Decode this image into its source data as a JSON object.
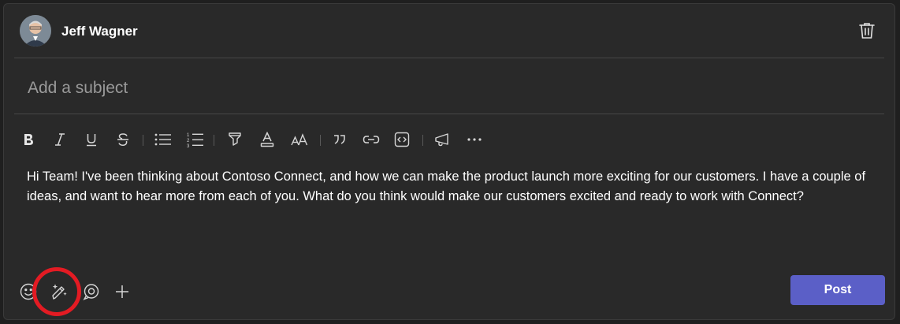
{
  "author": {
    "name": "Jeff Wagner"
  },
  "subject": {
    "placeholder": "Add a subject",
    "value": ""
  },
  "toolbar": {
    "items": [
      "bold",
      "italic",
      "underline",
      "strikethrough",
      "bulleted-list",
      "numbered-list",
      "highlight",
      "font-color",
      "font-size",
      "quote",
      "link",
      "code-snippet",
      "announcement",
      "more-options"
    ]
  },
  "message": {
    "text": "Hi Team! I've been thinking about Contoso Connect, and how we can make the product launch more exciting for our customers. I have a couple of ideas, and want to hear more from each of you. What do you think would make our customers excited and ready to work with Connect?"
  },
  "actions": {
    "post_label": "Post"
  },
  "colors": {
    "background": "#292929",
    "accent": "#5b5fc7",
    "highlight_ring": "#e31b23",
    "divider": "#474747",
    "icon": "#d6d6d6"
  }
}
